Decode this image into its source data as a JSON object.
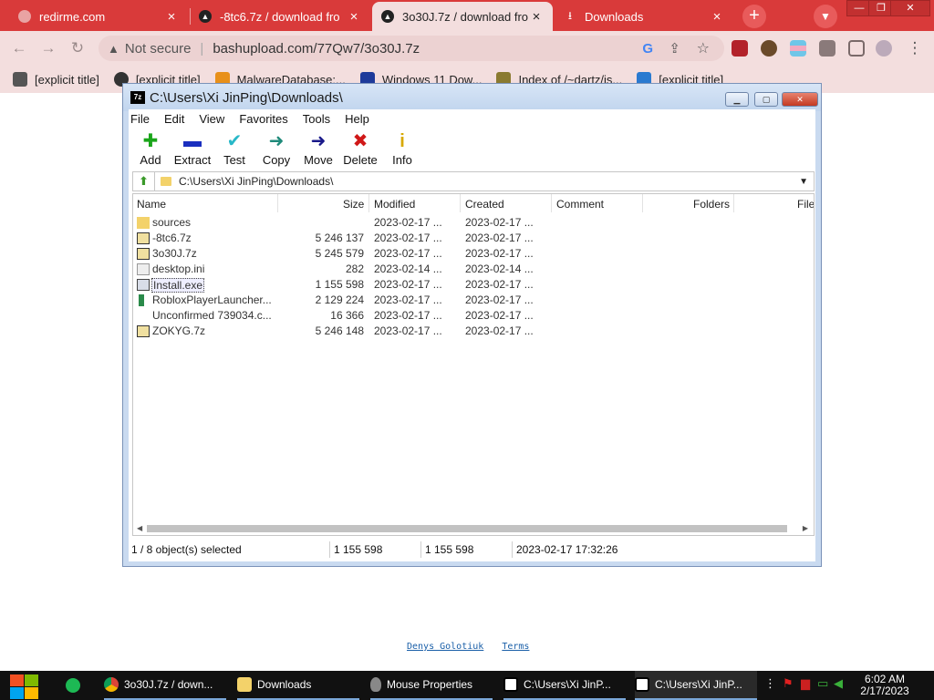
{
  "browser": {
    "tabs": [
      {
        "label": "redirme.com",
        "favicon": "globe-icon",
        "active": false
      },
      {
        "label": "-8tc6.7z / download fro",
        "favicon": "upload-cloud-icon",
        "active": false
      },
      {
        "label": "3o30J.7z / download fro",
        "favicon": "upload-cloud-icon",
        "active": true
      },
      {
        "label": "Downloads",
        "favicon": "download-icon",
        "active": false
      }
    ],
    "tab_close": "×",
    "new_tab": "+",
    "window_controls": [
      "—",
      "❐",
      "✕"
    ],
    "security_label": "Not secure",
    "url": "bashupload.com/77Qw7/3o30J.7z",
    "bookmarks": [
      "[explicit title]",
      "[explicit title]",
      "MalwareDatabase:...",
      "Windows 11 Dow...",
      "Index of /~dartz/is...",
      "[explicit title]"
    ]
  },
  "page": {
    "footer_links": [
      "Denys Golotiuk",
      "Terms"
    ]
  },
  "sevenzip": {
    "title": "C:\\Users\\Xi JinPing\\Downloads\\",
    "app_icon": "7z",
    "menu": [
      "File",
      "Edit",
      "View",
      "Favorites",
      "Tools",
      "Help"
    ],
    "toolbar": [
      {
        "label": "Add",
        "icon": "plus-icon",
        "glyph": "✚",
        "color": "#1aa51a"
      },
      {
        "label": "Extract",
        "icon": "minus-icon",
        "glyph": "▬",
        "color": "#1a2fbf"
      },
      {
        "label": "Test",
        "icon": "check-icon",
        "glyph": "✔",
        "color": "#28b8c8"
      },
      {
        "label": "Copy",
        "icon": "copy-arrow-icon",
        "glyph": "➜",
        "color": "#1f8a7a"
      },
      {
        "label": "Move",
        "icon": "move-arrow-icon",
        "glyph": "➜",
        "color": "#1a1a8a"
      },
      {
        "label": "Delete",
        "icon": "delete-x-icon",
        "glyph": "✖",
        "color": "#d01818"
      },
      {
        "label": "Info",
        "icon": "info-icon",
        "glyph": "i",
        "color": "#d8a800"
      }
    ],
    "path": "C:\\Users\\Xi JinPing\\Downloads\\",
    "columns": [
      "Name",
      "Size",
      "Modified",
      "Created",
      "Comment",
      "Folders",
      "File"
    ],
    "files": [
      {
        "name": "sources",
        "size": "",
        "modified": "2023-02-17 ...",
        "created": "2023-02-17 ...",
        "kind": "folder"
      },
      {
        "name": "-8tc6.7z",
        "size": "5 246 137",
        "modified": "2023-02-17 ...",
        "created": "2023-02-17 ...",
        "kind": "archive"
      },
      {
        "name": "3o30J.7z",
        "size": "5 245 579",
        "modified": "2023-02-17 ...",
        "created": "2023-02-17 ...",
        "kind": "archive"
      },
      {
        "name": "desktop.ini",
        "size": "282",
        "modified": "2023-02-14 ...",
        "created": "2023-02-14 ...",
        "kind": "settings"
      },
      {
        "name": "Install.exe",
        "size": "1 155 598",
        "modified": "2023-02-17 ...",
        "created": "2023-02-17 ...",
        "kind": "exe",
        "selected": true
      },
      {
        "name": "RobloxPlayerLauncher...",
        "size": "2 129 224",
        "modified": "2023-02-17 ...",
        "created": "2023-02-17 ...",
        "kind": "roblox"
      },
      {
        "name": "Unconfirmed 739034.c...",
        "size": "16 366",
        "modified": "2023-02-17 ...",
        "created": "2023-02-17 ...",
        "kind": "blank"
      },
      {
        "name": "ZOKYG.7z",
        "size": "5 246 148",
        "modified": "2023-02-17 ...",
        "created": "2023-02-17 ...",
        "kind": "archive"
      }
    ],
    "status": [
      "1 / 8 object(s) selected",
      "1 155 598",
      "1 155 598",
      "2023-02-17 17:32:26"
    ]
  },
  "taskbar": {
    "apps": [
      {
        "label": "3o30J.7z / down...",
        "icon": "chrome-icon"
      },
      {
        "label": "Downloads",
        "icon": "folder-icon"
      },
      {
        "label": "Mouse Properties",
        "icon": "mouse-icon"
      },
      {
        "label": "C:\\Users\\Xi JinP...",
        "icon": "sevenzip-icon"
      },
      {
        "label": "C:\\Users\\Xi JinP...",
        "icon": "sevenzip-icon"
      }
    ],
    "time": "6:02 AM",
    "date": "2/17/2023"
  }
}
